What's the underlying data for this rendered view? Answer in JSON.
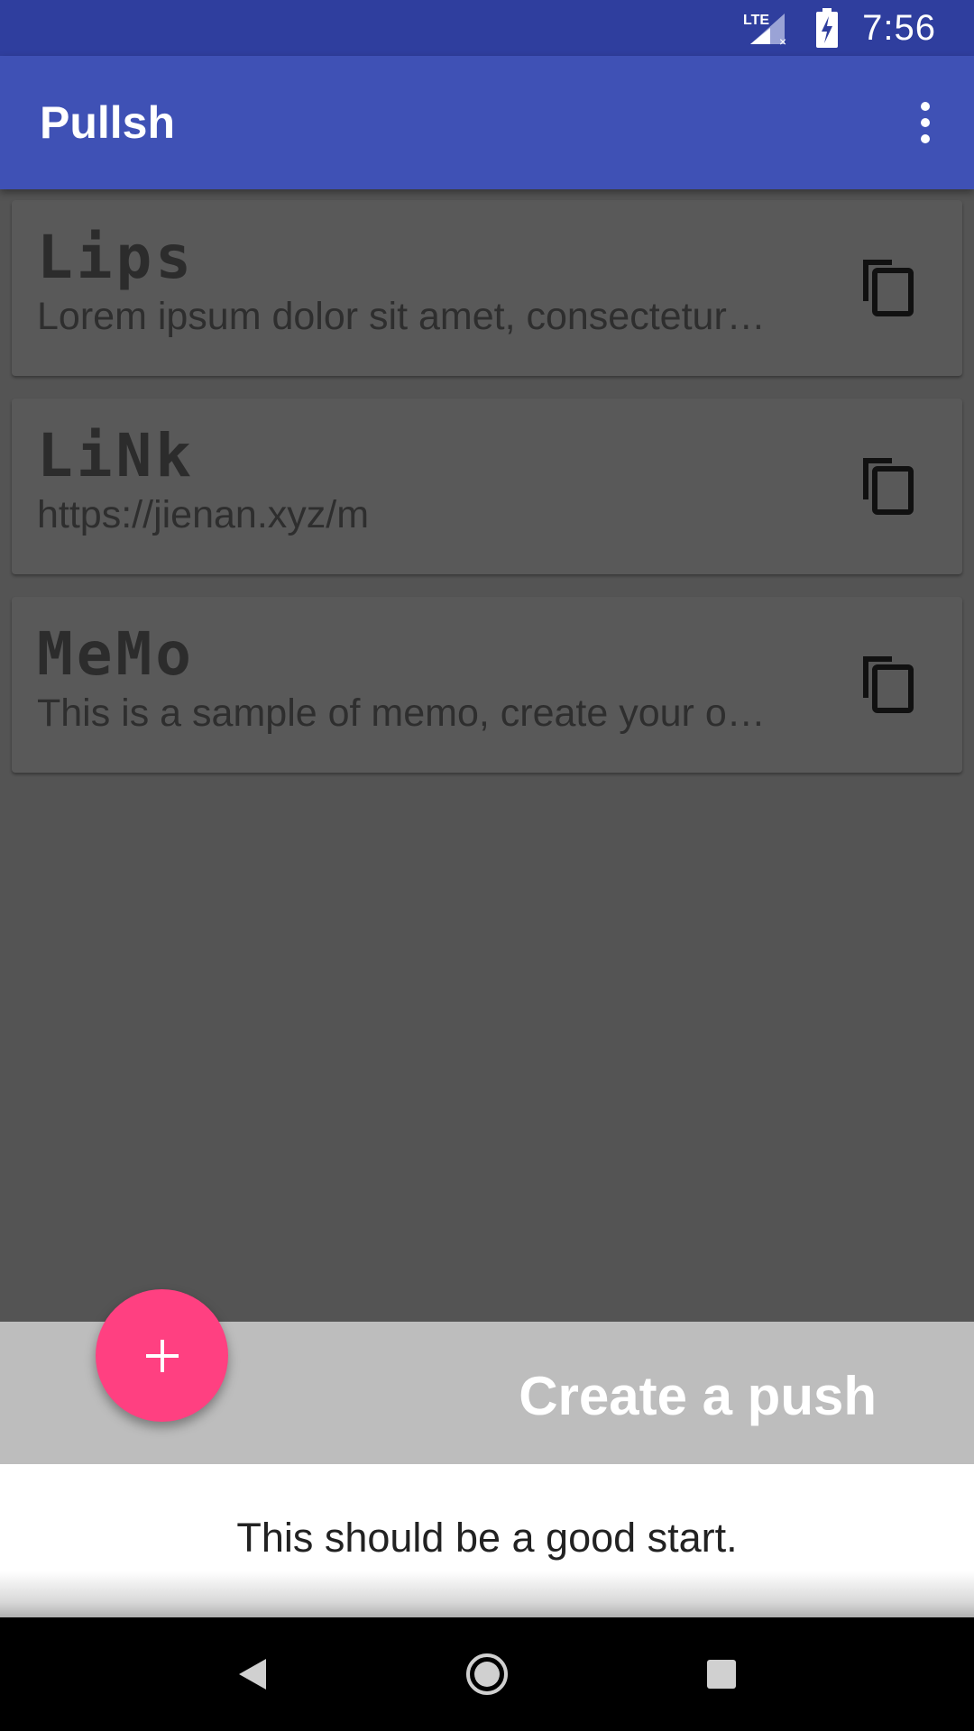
{
  "status_bar": {
    "network": "LTE",
    "time": "7:56"
  },
  "app_bar": {
    "title": "Pullsh",
    "menu_icon": "more-vert-icon"
  },
  "items": [
    {
      "title": "Lips",
      "body": "Lorem ipsum dolor sit amet, consectetur…",
      "action_icon": "copy-icon"
    },
    {
      "title": "LiNk",
      "body": "https://jienan.xyz/m",
      "action_icon": "copy-icon"
    },
    {
      "title": "MeMo",
      "body": "This is a sample of memo, create your o…",
      "action_icon": "copy-icon"
    }
  ],
  "sheet": {
    "title": "Create a push",
    "message": "This should be a good start."
  },
  "fab": {
    "icon": "plus-icon"
  },
  "nav": {
    "back_icon": "back-icon",
    "home_icon": "home-icon",
    "recents_icon": "recents-icon"
  },
  "colors": {
    "primary": "#3f51b5",
    "primary_dark": "#2f3e9e",
    "accent": "#ff4081"
  }
}
